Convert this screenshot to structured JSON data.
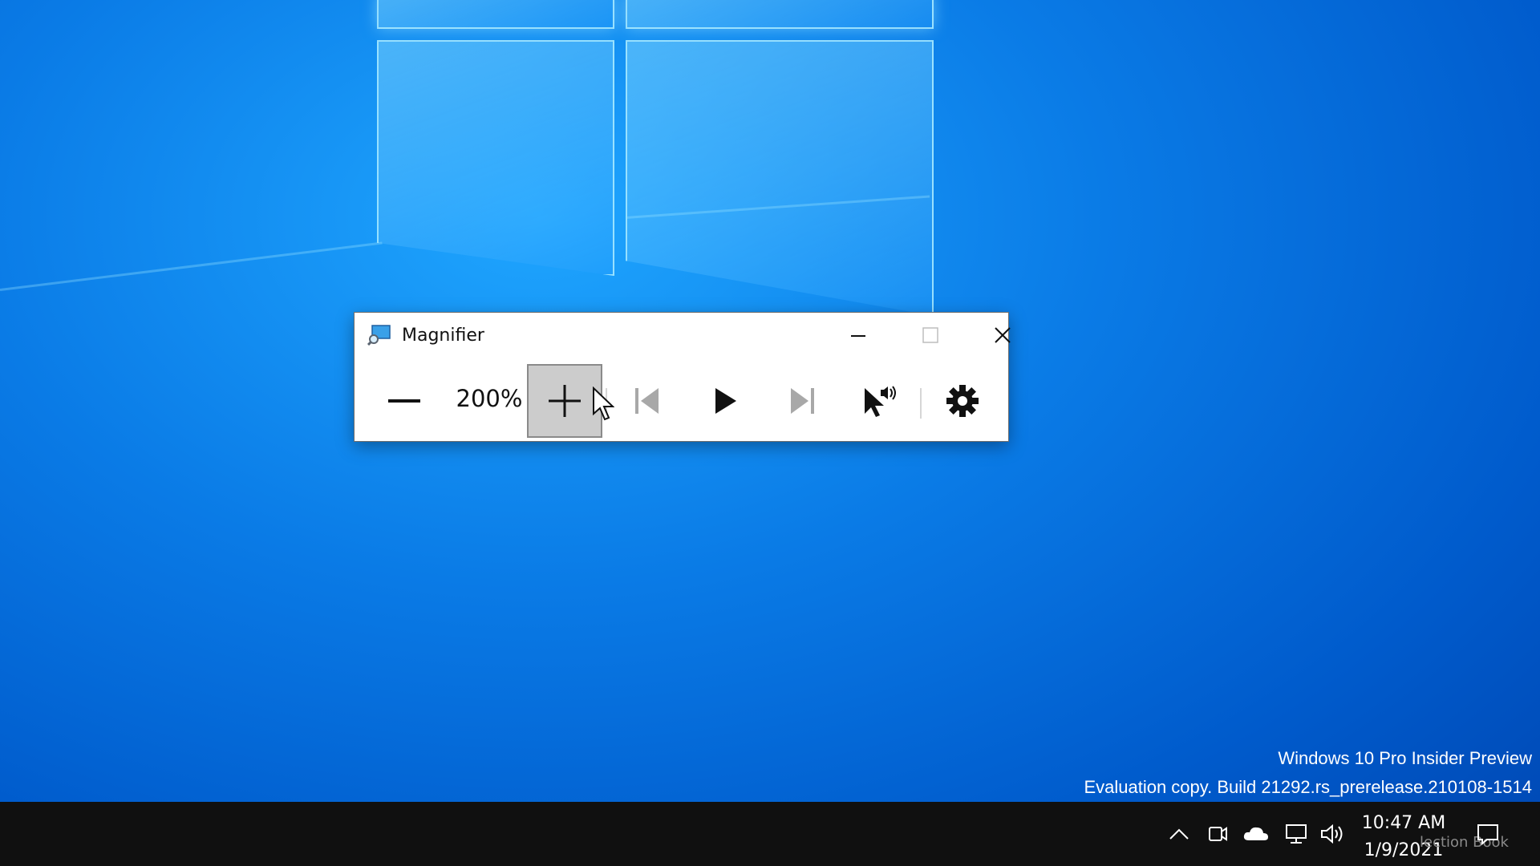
{
  "window": {
    "title": "Magnifier",
    "zoom_level": "200%"
  },
  "toolbar": {
    "zoom_out": "zoom out",
    "zoom_in": "zoom in"
  },
  "watermark": {
    "line1": "Windows 10 Pro Insider Preview",
    "line2": "Evaluation copy. Build 21292.rs_prerelease.210108-1514"
  },
  "taskbar": {
    "time": "10:47 AM",
    "date": "1/9/2021",
    "overlay_text": "lection Book"
  },
  "colors": {
    "desktop": "#0a7be6",
    "taskbar": "#101010",
    "active_button": "#cccccc"
  }
}
